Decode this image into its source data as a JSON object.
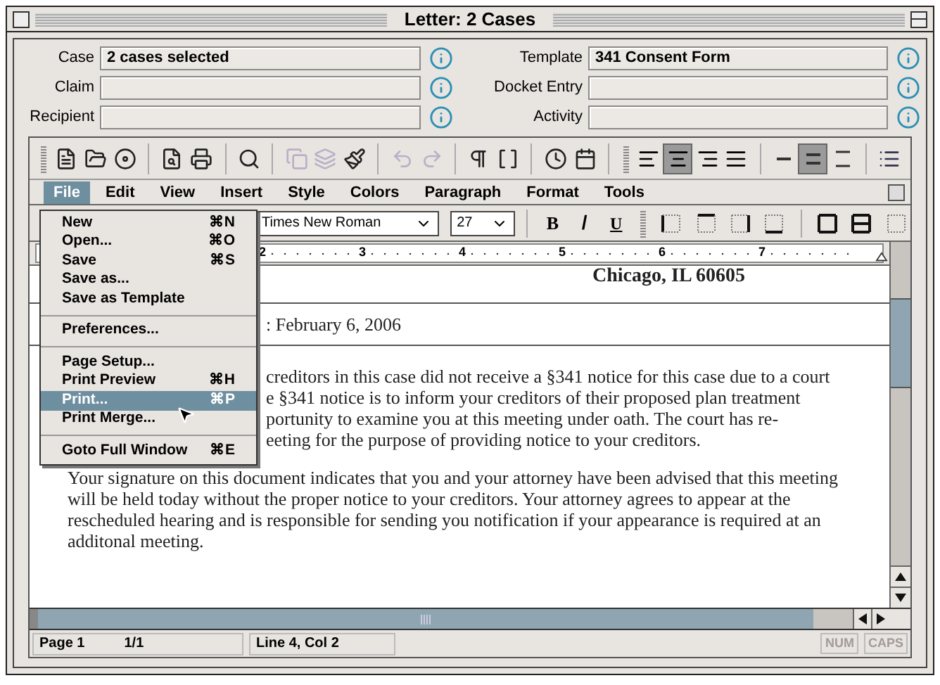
{
  "window": {
    "title": "Letter: 2 Cases"
  },
  "fields_left": [
    {
      "label": "Case",
      "value": "2 cases selected"
    },
    {
      "label": "Claim"
    },
    {
      "label": "Recipient"
    }
  ],
  "fields_right": [
    {
      "label": "Template",
      "value": "341 Consent Form"
    },
    {
      "label": "Docket Entry"
    },
    {
      "label": "Activity"
    }
  ],
  "toolbar": {
    "groups": [
      [
        {
          "disabled": false
        },
        {
          "disabled": false
        },
        {
          "disabled": false
        }
      ],
      [
        {
          "disabled": false
        },
        {
          "disabled": false
        }
      ],
      [
        {
          "disabled": false
        }
      ],
      [
        {
          "disabled": true
        },
        {
          "disabled": true
        },
        {
          "disabled": false
        }
      ],
      [
        {
          "disabled": true
        },
        {
          "disabled": true
        }
      ],
      [
        {
          "disabled": false
        },
        {
          "disabled": false
        }
      ],
      [
        {
          "disabled": false
        },
        {
          "disabled": false
        }
      ]
    ],
    "alignment": [
      {
        "selected": false
      },
      {
        "selected": true
      },
      {
        "selected": false
      },
      {
        "selected": false
      }
    ],
    "spacing": [
      {
        "selected": false
      },
      {
        "selected": true
      },
      {
        "selected": false
      }
    ]
  },
  "menubar": [
    {
      "label": "File",
      "selected": true
    },
    {
      "label": "Edit",
      "selected": false
    },
    {
      "label": "View",
      "selected": false
    },
    {
      "label": "Insert",
      "selected": false
    },
    {
      "label": "Style",
      "selected": false
    },
    {
      "label": "Colors",
      "selected": false
    },
    {
      "label": "Paragraph",
      "selected": false
    },
    {
      "label": "Format",
      "selected": false
    },
    {
      "label": "Tools",
      "selected": false
    }
  ],
  "file_menu": [
    {
      "kind": "item",
      "label": "New",
      "shortcut": "⌘N",
      "selected": false
    },
    {
      "kind": "item",
      "label": "Open...",
      "shortcut": "⌘O",
      "selected": false
    },
    {
      "kind": "item",
      "label": "Save",
      "shortcut": "⌘S",
      "selected": false
    },
    {
      "kind": "item",
      "label": "Save as...",
      "selected": false
    },
    {
      "kind": "item",
      "label": "Save as Template",
      "selected": false
    },
    {
      "kind": "separator"
    },
    {
      "kind": "item",
      "label": "Preferences...",
      "selected": false
    },
    {
      "kind": "separator"
    },
    {
      "kind": "item",
      "label": "Page Setup...",
      "selected": false
    },
    {
      "kind": "item",
      "label": "Print Preview",
      "shortcut": "⌘H",
      "selected": false
    },
    {
      "kind": "item",
      "label": "Print...",
      "shortcut": "⌘P",
      "selected": true
    },
    {
      "kind": "item",
      "label": "Print Merge...",
      "selected": false
    },
    {
      "kind": "separator"
    },
    {
      "kind": "item",
      "label": "Goto Full Window",
      "shortcut": "⌘E",
      "selected": false
    }
  ],
  "format_bar": {
    "font": "Times New Roman",
    "size": "27",
    "bold": "B",
    "italic": "/",
    "underline": "U"
  },
  "ruler": {
    "labels": [
      "2",
      "3",
      "4",
      "5",
      "6",
      "7"
    ]
  },
  "document": {
    "address": "Chicago, IL 60605",
    "date": ": February 6, 2006",
    "partial_lines": [
      "creditors in this case did not receive a §341 notice for this case due to a court",
      "e §341 notice is to inform your creditors of their proposed plan treatment",
      "portunity to examine you at this meeting under oath. The court has re-",
      "eeting for the purpose of providing notice to your creditors."
    ],
    "paragraph": "Your signature on this document indicates that you and your attorney have been advised that this meeting will be held today without the  proper notice to your creditors. Your attorney agrees to appear at the rescheduled hearing and is responsible for sending you notification if your appearance is required at an additonal meeting."
  },
  "status_bar": {
    "page": "Page 1",
    "pages": "1/1",
    "position": "Line 4, Col 2",
    "indicators": [
      {
        "label": "NUM",
        "disabled": true
      },
      {
        "label": "CAPS",
        "disabled": true
      }
    ]
  }
}
